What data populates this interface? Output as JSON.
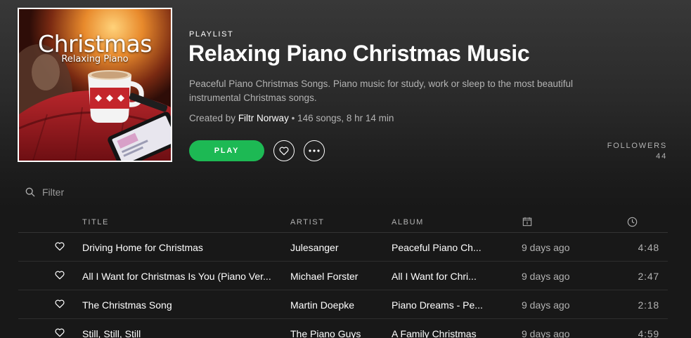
{
  "cover": {
    "title": "Christmas",
    "subtitle": "Relaxing Piano"
  },
  "header": {
    "type_label": "PLAYLIST",
    "title": "Relaxing Piano Christmas Music",
    "description": "Peaceful Piano Christmas Songs. Piano music for study, work or sleep to the most beautiful instrumental Christmas songs.",
    "created_prefix": "Created by",
    "owner": "Filtr Norway",
    "stats": " • 146 songs, 8 hr 14 min",
    "play_label": "PLAY",
    "followers_label": "FOLLOWERS",
    "followers_count": "44"
  },
  "icons": {
    "heart": "heart-icon",
    "more": "more-icon",
    "search": "search-icon",
    "calendar": "calendar-icon",
    "clock": "clock-icon"
  },
  "colors": {
    "accent": "#1db954",
    "background": "#181818",
    "muted_text": "#b3b3b3"
  },
  "filter": {
    "placeholder": "Filter"
  },
  "table": {
    "columns": {
      "title": "TITLE",
      "artist": "ARTIST",
      "album": "ALBUM"
    },
    "rows": [
      {
        "title": "Driving Home for Christmas",
        "artist": "Julesanger",
        "album": "Peaceful Piano Ch...",
        "added": "9 days ago",
        "duration": "4:48"
      },
      {
        "title": "All I Want for Christmas Is You (Piano Ver...",
        "artist": "Michael Forster",
        "album": "All I Want for Chri...",
        "added": "9 days ago",
        "duration": "2:47"
      },
      {
        "title": "The Christmas Song",
        "artist": "Martin Doepke",
        "album": "Piano Dreams - Pe...",
        "added": "9 days ago",
        "duration": "2:18"
      },
      {
        "title": "Still, Still, Still",
        "artist": "The Piano Guys",
        "album": "A Family Christmas",
        "added": "9 days ago",
        "duration": "4:59"
      }
    ]
  }
}
